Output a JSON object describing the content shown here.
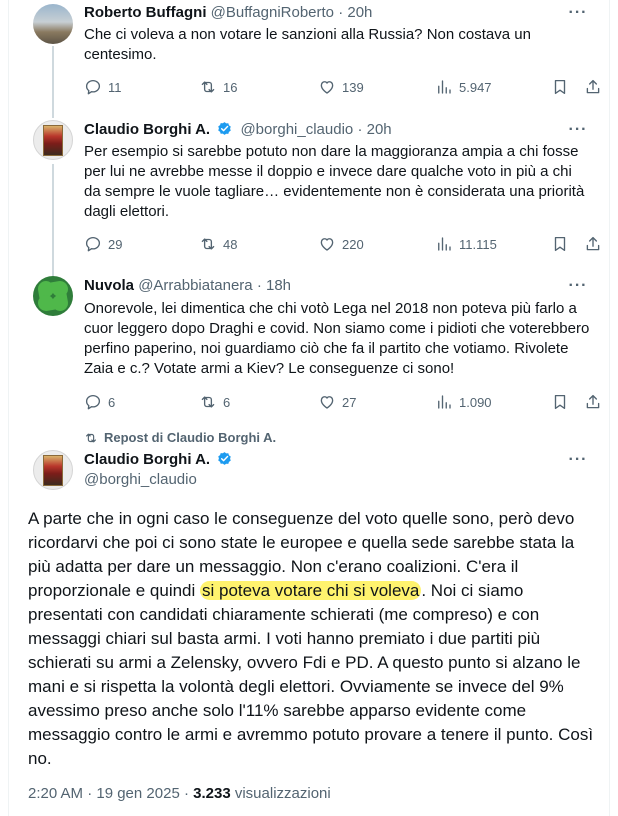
{
  "tweets": [
    {
      "name": "Roberto Buffagni",
      "handle": "@BuffagniRoberto",
      "dot": "·",
      "time": "20h",
      "text": "Che ci voleva a non votare le sanzioni alla Russia? Non costava un centesimo.",
      "replies": "11",
      "reposts": "16",
      "likes": "139",
      "views": "5.947",
      "verified": false
    },
    {
      "name": "Claudio Borghi A.",
      "handle": "@borghi_claudio",
      "dot": "·",
      "time": "20h",
      "text": "Per esempio si sarebbe potuto non dare la maggioranza ampia a chi fosse per lui ne avrebbe messe il doppio e invece dare qualche voto in più a chi da sempre le vuole tagliare… evidentemente non è considerata una priorità dagli elettori.",
      "replies": "29",
      "reposts": "48",
      "likes": "220",
      "views": "11.115",
      "verified": true
    },
    {
      "name": "Nuvola",
      "handle": "@Arrabbiatanera",
      "dot": "·",
      "time": "18h",
      "text": "Onorevole, lei dimentica che chi votò Lega nel 2018 non poteva più farlo a cuor leggero dopo Draghi e covid. Non siamo come i pidioti che voterebbero perfino paperino, noi guardiamo ciò che fa il partito che votiamo. Rivolete Zaia e c.? Votate armi a Kiev? Le conseguenze ci sono!",
      "replies": "6",
      "reposts": "6",
      "likes": "27",
      "views": "1.090",
      "verified": false
    }
  ],
  "repost_label": "Repost di Claudio Borghi A.",
  "main": {
    "name": "Claudio Borghi A.",
    "handle": "@borghi_claudio",
    "text_before": "A parte che in ogni caso le conseguenze del voto quelle sono, però devo ricordarvi che poi ci sono state le europee e quella sede sarebbe stata la più adatta per dare un messaggio. Non c'erano coalizioni. C'era il proporzionale e quindi ",
    "text_highlight": "si poteva votare chi si voleva",
    "text_after": ". Noi ci siamo presentati con candidati chiaramente schierati (me compreso) e con messaggi chiari sul basta armi. I voti hanno premiato i due partiti più schierati su armi a Zelensky, ovvero Fdi e PD. A questo punto si alzano le mani e si rispetta la volontà degli elettori. Ovviamente se invece del 9% avessimo preso anche solo l'11% sarebbe apparso evidente come messaggio contro le armi e avremmo potuto provare a tenere il punto. Così no.",
    "timestamp": "2:20 AM · 19 gen 2025 · ",
    "views_count": "3.233",
    "views_label": " visualizzazioni"
  },
  "more_label": "···",
  "colors": {
    "verified": "#1d9bf0",
    "highlight": "#fff36e",
    "muted": "#536471"
  }
}
